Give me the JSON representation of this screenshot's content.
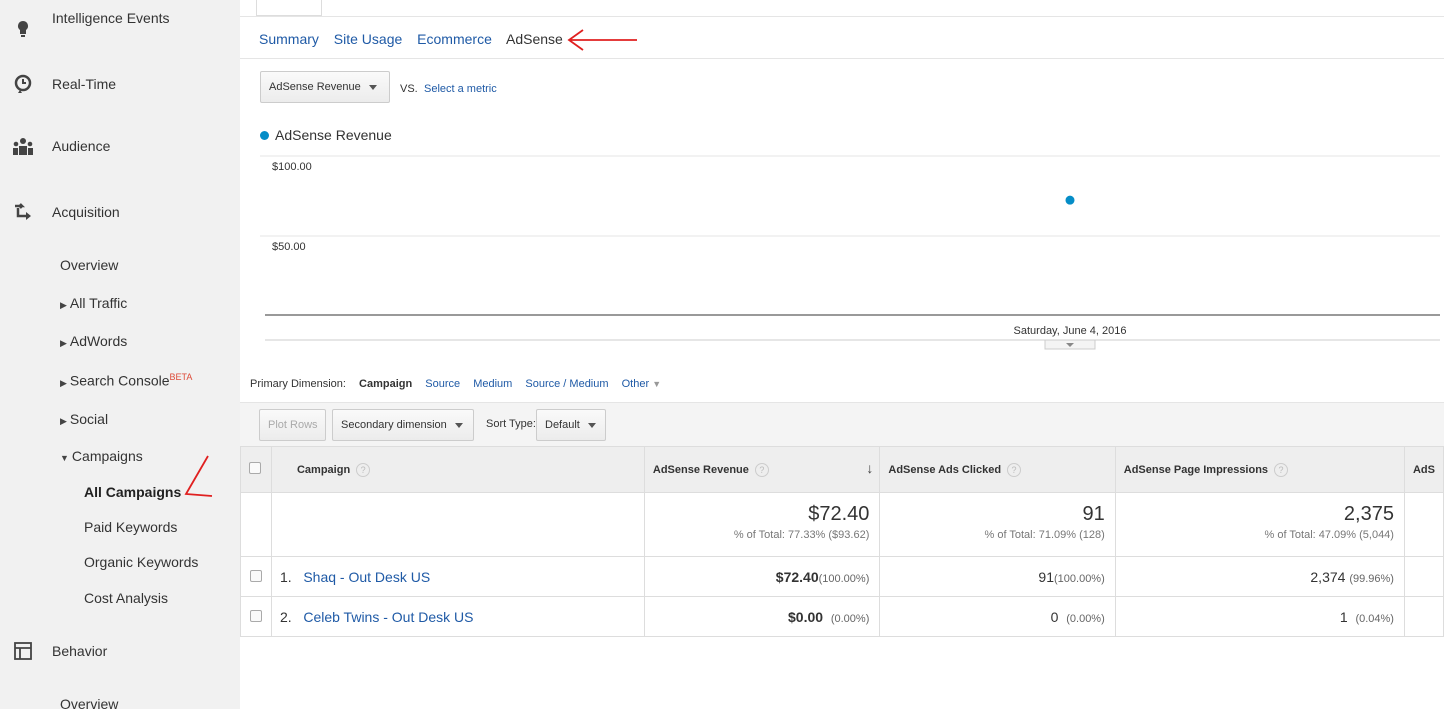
{
  "sidebar": {
    "top_items": [
      {
        "label": "Intelligence Events",
        "icon": "lightbulb-icon"
      },
      {
        "label": "Real-Time",
        "icon": "clock-icon"
      },
      {
        "label": "Audience",
        "icon": "people-icon"
      },
      {
        "label": "Acquisition",
        "icon": "acquisition-icon"
      }
    ],
    "acquisition_items": {
      "overview": "Overview",
      "all_traffic": "All Traffic",
      "adwords": "AdWords",
      "search_console": "Search Console",
      "search_console_badge": "BETA",
      "social": "Social",
      "campaigns": "Campaigns"
    },
    "campaign_items": [
      "All Campaigns",
      "Paid Keywords",
      "Organic Keywords",
      "Cost Analysis"
    ],
    "behavior": {
      "label": "Behavior",
      "icon": "layout-icon",
      "overview": "Overview"
    }
  },
  "tabs": [
    "Summary",
    "Site Usage",
    "Ecommerce",
    "AdSense"
  ],
  "metric_selector": {
    "value": "AdSense Revenue",
    "vs": "VS.",
    "select_metric": "Select a metric"
  },
  "chart_data": {
    "type": "scatter",
    "series": [
      {
        "name": "AdSense Revenue",
        "color": "#058dc7",
        "points": [
          {
            "x": "Saturday, June 4, 2016",
            "y": 72.4
          }
        ]
      }
    ],
    "yticks": [
      "$100.00",
      "$50.00"
    ],
    "ylim": [
      0,
      100
    ],
    "xlabel_tooltip": "Saturday, June 4, 2016",
    "grid": true
  },
  "dimensions": {
    "label": "Primary Dimension:",
    "active": "Campaign",
    "options": [
      "Source",
      "Medium",
      "Source / Medium"
    ],
    "other": "Other"
  },
  "controls": {
    "plot_rows": "Plot Rows",
    "secondary": "Secondary dimension",
    "sort_type_label": "Sort Type:",
    "sort_type_value": "Default"
  },
  "table": {
    "headers": {
      "campaign": "Campaign",
      "revenue": "AdSense Revenue",
      "clicked": "AdSense Ads Clicked",
      "impressions": "AdSense Page Impressions",
      "next": "AdS"
    },
    "totals": {
      "revenue": "$72.40",
      "revenue_pct": "% of Total: 77.33% ($93.62)",
      "clicked": "91",
      "clicked_pct": "% of Total: 71.09% (128)",
      "impressions": "2,375",
      "impressions_pct": "% of Total: 47.09% (5,044)"
    },
    "rows": [
      {
        "num": "1.",
        "campaign": "Shaq - Out Desk US",
        "revenue": "$72.40",
        "revenue_pct": "(100.00%)",
        "clicked": "91",
        "clicked_pct": "(100.00%)",
        "impressions": "2,374",
        "impressions_pct": "(99.96%)"
      },
      {
        "num": "2.",
        "campaign": "Celeb Twins - Out Desk US",
        "revenue": "$0.00",
        "revenue_pct": "(0.00%)",
        "clicked": "0",
        "clicked_pct": "(0.00%)",
        "impressions": "1",
        "impressions_pct": "(0.04%)"
      }
    ]
  },
  "colors": {
    "link": "#1f5aa6",
    "series": "#058dc7",
    "annotation": "#e02020"
  }
}
